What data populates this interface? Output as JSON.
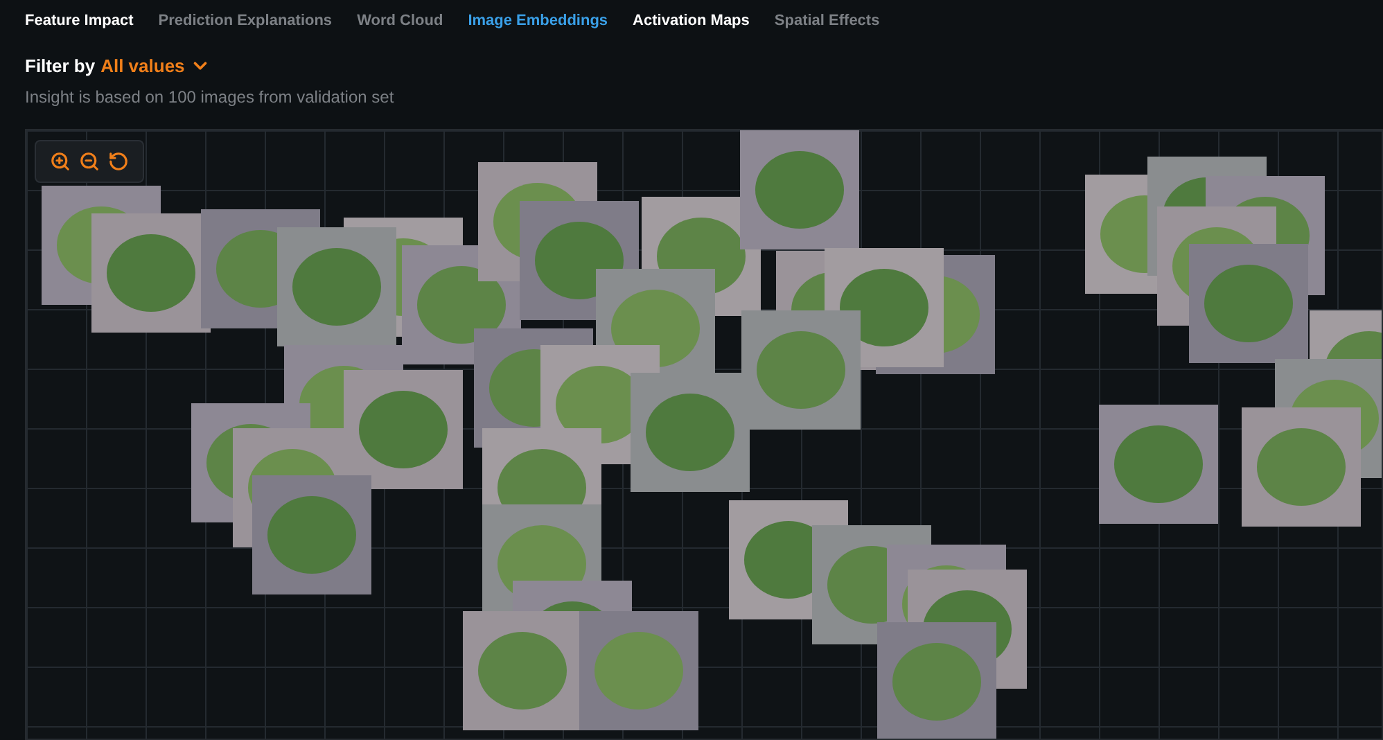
{
  "tabs": [
    {
      "label": "Feature Impact",
      "selected": false,
      "disabled": false
    },
    {
      "label": "Prediction Explanations",
      "selected": false,
      "disabled": true
    },
    {
      "label": "Word Cloud",
      "selected": false,
      "disabled": true
    },
    {
      "label": "Image Embeddings",
      "selected": true,
      "disabled": false
    },
    {
      "label": "Activation Maps",
      "selected": false,
      "disabled": false
    },
    {
      "label": "Spatial Effects",
      "selected": false,
      "disabled": true
    }
  ],
  "filter": {
    "label": "Filter by",
    "value": "All values"
  },
  "note": "Insight is based on 100 images from validation set"
}
